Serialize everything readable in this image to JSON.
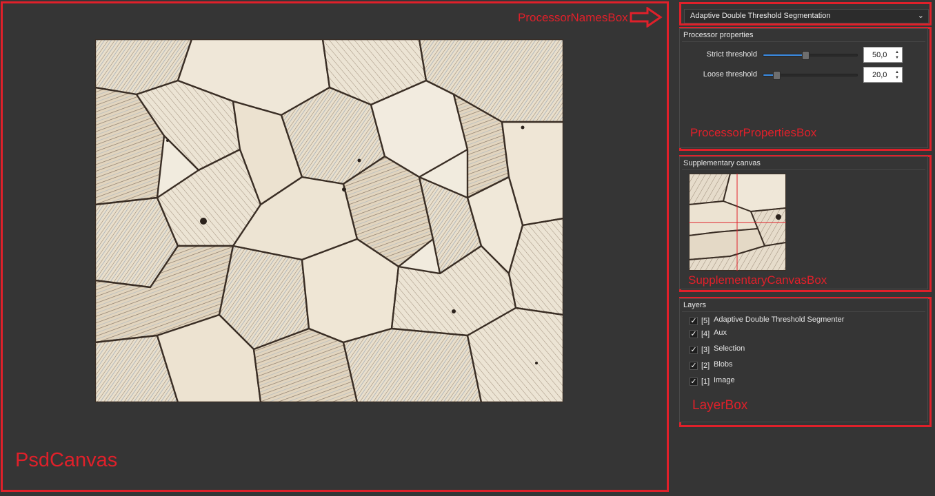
{
  "annotations": {
    "psd_canvas": "PsdCanvas",
    "processor_names_box": "ProcessorNamesBox",
    "processor_properties_box": "ProcessorPropertiesBox",
    "supplementary_canvas_box": "SupplementaryCanvasBox",
    "layer_box": "LayerBox",
    "color": "#e0202a"
  },
  "processor_select": {
    "selected": "Adaptive Double Threshold Segmentation",
    "icon": "chevron-down-icon"
  },
  "processor_properties": {
    "title": "Processor properties",
    "properties": [
      {
        "label": "Strict threshold",
        "value": "50,0",
        "slider_fraction": 0.45
      },
      {
        "label": "Loose threshold",
        "value": "20,0",
        "slider_fraction": 0.14
      }
    ]
  },
  "supplementary": {
    "title": "Supplementary canvas"
  },
  "layers": {
    "title": "Layers",
    "items": [
      {
        "index": "[5]",
        "name": "Adaptive Double Threshold Segmenter",
        "checked": true
      },
      {
        "index": "[4]",
        "name": "Aux",
        "checked": true
      },
      {
        "index": "[3]",
        "name": "Selection",
        "checked": true
      },
      {
        "index": "[2]",
        "name": "Blobs",
        "checked": true
      },
      {
        "index": "[1]",
        "name": "Image",
        "checked": true
      }
    ]
  },
  "colors": {
    "background": "#353535",
    "annotation_red": "#e0202a",
    "slider_accent": "#3d8ee6"
  }
}
